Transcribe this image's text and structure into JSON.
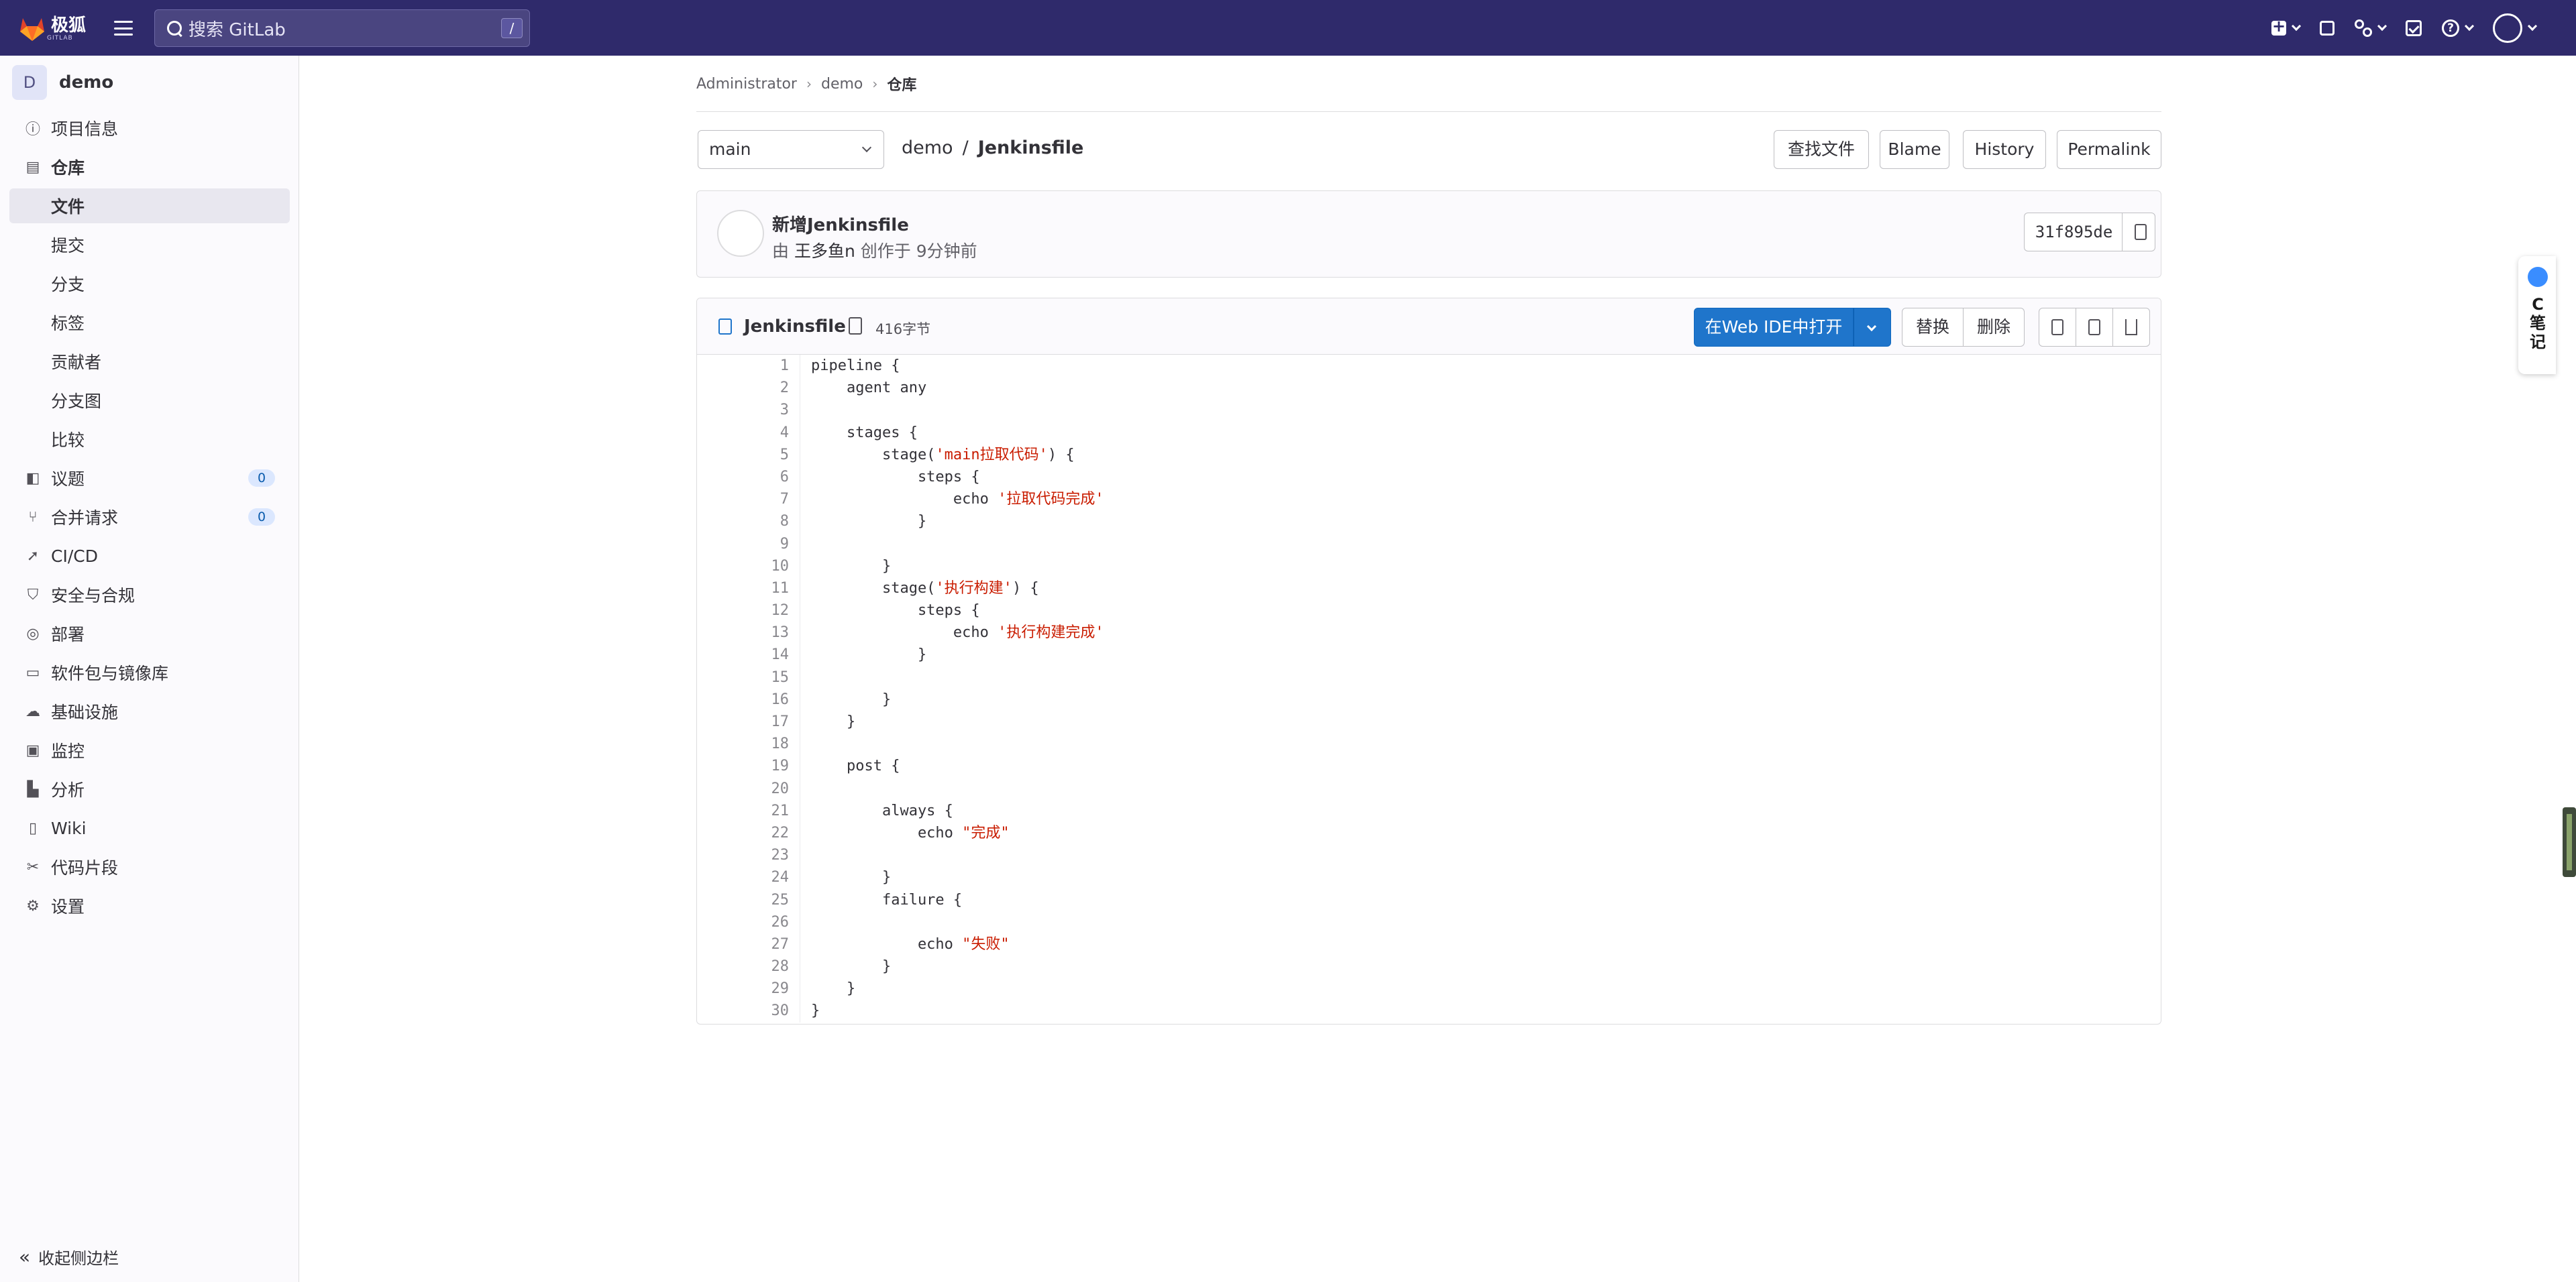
{
  "topbar": {
    "logo_text": "极狐",
    "logo_sub": "GITLAB",
    "search_placeholder": "搜索 GitLab",
    "search_shortcut": "/"
  },
  "project": {
    "avatar_letter": "D",
    "name": "demo"
  },
  "sidebar": {
    "items": [
      {
        "label": "项目信息",
        "icon": "info-icon"
      },
      {
        "label": "仓库",
        "icon": "repository-icon"
      },
      {
        "label": "文件",
        "sub": true,
        "active": true
      },
      {
        "label": "提交",
        "sub": true
      },
      {
        "label": "分支",
        "sub": true
      },
      {
        "label": "标签",
        "sub": true
      },
      {
        "label": "贡献者",
        "sub": true
      },
      {
        "label": "分支图",
        "sub": true
      },
      {
        "label": "比较",
        "sub": true
      },
      {
        "label": "议题",
        "icon": "issues-icon",
        "badge": "0"
      },
      {
        "label": "合并请求",
        "icon": "merge-request-icon",
        "badge": "0"
      },
      {
        "label": "CI/CD",
        "icon": "rocket-icon"
      },
      {
        "label": "安全与合规",
        "icon": "shield-icon"
      },
      {
        "label": "部署",
        "icon": "deploy-icon"
      },
      {
        "label": "软件包与镜像库",
        "icon": "package-icon"
      },
      {
        "label": "基础设施",
        "icon": "cloud-icon"
      },
      {
        "label": "监控",
        "icon": "monitor-icon"
      },
      {
        "label": "分析",
        "icon": "chart-icon"
      },
      {
        "label": "Wiki",
        "icon": "book-icon"
      },
      {
        "label": "代码片段",
        "icon": "scissors-icon"
      },
      {
        "label": "设置",
        "icon": "gear-icon"
      }
    ],
    "collapse_label": "收起侧边栏"
  },
  "breadcrumb": {
    "items": [
      "Administrator",
      "demo",
      "仓库"
    ]
  },
  "branch": {
    "selected": "main"
  },
  "path": {
    "root": "demo",
    "separator": "/",
    "file": "Jenkinsfile"
  },
  "toolbar": {
    "find_file": "查找文件",
    "blame": "Blame",
    "history": "History",
    "permalink": "Permalink"
  },
  "commit": {
    "title": "新增Jenkinsfile",
    "by": "由",
    "author": "王多鱼n",
    "authored": "创作于 9分钟前",
    "sha": "31f895de"
  },
  "file": {
    "name": "Jenkinsfile",
    "size": "416字节",
    "open_ide": "在Web IDE中打开",
    "replace": "替换",
    "delete": "删除"
  },
  "code_lines": [
    {
      "n": "1",
      "code": "pipeline {"
    },
    {
      "n": "2",
      "code": "    agent any"
    },
    {
      "n": "3",
      "code": ""
    },
    {
      "n": "4",
      "code": "    stages {"
    },
    {
      "n": "5",
      "pre": "        stage(",
      "str": "'main拉取代码'",
      "post": ") {"
    },
    {
      "n": "6",
      "code": "            steps {"
    },
    {
      "n": "7",
      "pre": "                echo ",
      "str": "'拉取代码完成'",
      "post": ""
    },
    {
      "n": "8",
      "code": "            }"
    },
    {
      "n": "9",
      "code": ""
    },
    {
      "n": "10",
      "code": "        }"
    },
    {
      "n": "11",
      "pre": "        stage(",
      "str": "'执行构建'",
      "post": ") {"
    },
    {
      "n": "12",
      "code": "            steps {"
    },
    {
      "n": "13",
      "pre": "                echo ",
      "str": "'执行构建完成'",
      "post": ""
    },
    {
      "n": "14",
      "code": "            }"
    },
    {
      "n": "15",
      "code": ""
    },
    {
      "n": "16",
      "code": "        }"
    },
    {
      "n": "17",
      "code": "    }"
    },
    {
      "n": "18",
      "code": ""
    },
    {
      "n": "19",
      "code": "    post {"
    },
    {
      "n": "20",
      "code": ""
    },
    {
      "n": "21",
      "code": "        always {"
    },
    {
      "n": "22",
      "pre": "            echo ",
      "str": "\"完成\"",
      "post": ""
    },
    {
      "n": "23",
      "code": ""
    },
    {
      "n": "24",
      "code": "        }"
    },
    {
      "n": "25",
      "code": "        failure {"
    },
    {
      "n": "26",
      "code": ""
    },
    {
      "n": "27",
      "pre": "            echo ",
      "str": "\"失败\"",
      "post": ""
    },
    {
      "n": "28",
      "code": "        }"
    },
    {
      "n": "29",
      "code": "    }"
    },
    {
      "n": "30",
      "code": "}"
    }
  ],
  "floating_widget": {
    "text": "C笔记"
  },
  "colors": {
    "topbar": "#2f2a6b",
    "primary": "#1f75cb",
    "string": "#c91c00"
  }
}
